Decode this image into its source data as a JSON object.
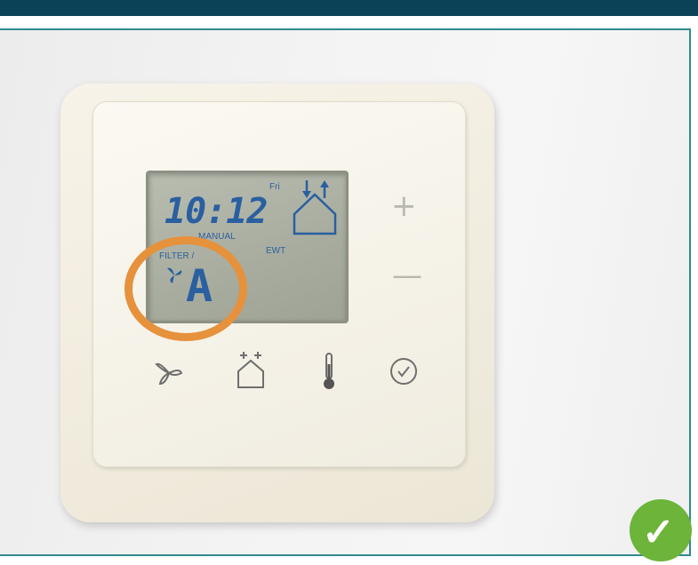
{
  "display": {
    "time": "10:12",
    "day": "Fri",
    "mode": "MANUAL",
    "filter_label": "FILTER /",
    "ewt_label": "EWT",
    "value": "A"
  },
  "controls": {
    "plus": "+",
    "minus": "—"
  },
  "icons": [
    "fan-icon",
    "house-icon",
    "thermometer-icon",
    "clock-icon",
    "checkmark-icon"
  ],
  "colors": {
    "lcd_text": "#2a5fa0",
    "highlight_circle": "#e6913c",
    "check_badge": "#6cb43a",
    "top_bar": "#0c4257",
    "frame_border": "#2f8a8f"
  }
}
